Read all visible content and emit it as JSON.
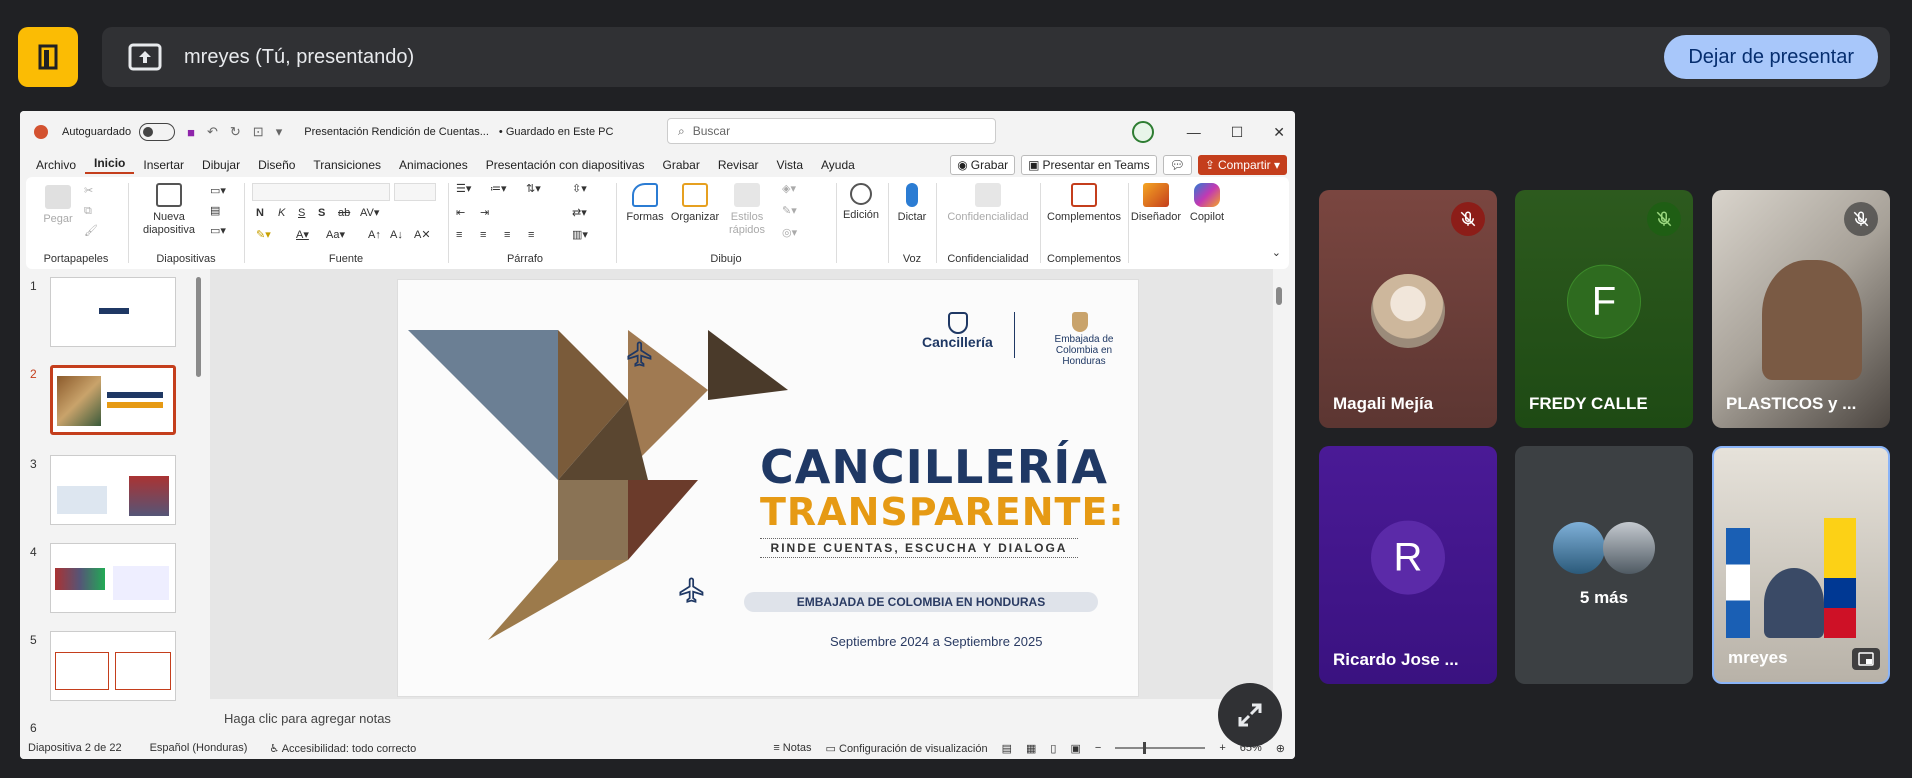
{
  "meet": {
    "presenter_label": "mreyes (Tú, presentando)",
    "stop_presenting_label": "Dejar de presentar"
  },
  "ppt": {
    "autosave_label": "Autoguardado",
    "file_name": "Presentación Rendición de Cuentas...",
    "save_status": "• Guardado en Este PC",
    "search_placeholder": "Buscar",
    "menu": [
      "Archivo",
      "Inicio",
      "Insertar",
      "Dibujar",
      "Diseño",
      "Transiciones",
      "Animaciones",
      "Presentación con diapositivas",
      "Grabar",
      "Revisar",
      "Vista",
      "Ayuda"
    ],
    "record_btn": "Grabar",
    "teams_btn": "Presentar en Teams",
    "share_btn": "Compartir",
    "ribbon": {
      "pegar": "Pegar",
      "portapapeles": "Portapapeles",
      "nueva_diapositiva": "Nueva diapositiva",
      "diapositivas": "Diapositivas",
      "fuente": "Fuente",
      "parrafo": "Párrafo",
      "formas": "Formas",
      "organizar": "Organizar",
      "estilos": "Estilos rápidos",
      "dibujo": "Dibujo",
      "edicion": "Edición",
      "dictar": "Dictar",
      "voz": "Voz",
      "confidencialidad_btn": "Confidencialidad",
      "confidencialidad": "Confidencialidad",
      "complementos_btn": "Complementos",
      "complementos": "Complementos",
      "disenador": "Diseñador",
      "copilot": "Copilot"
    },
    "thumb_numbers": [
      "1",
      "2",
      "3",
      "4",
      "5",
      "6"
    ],
    "notes_placeholder": "Haga clic para agregar notas",
    "status": {
      "slide_count": "Diapositiva 2 de 22",
      "language": "Español (Honduras)",
      "accessibility": "Accesibilidad: todo correcto",
      "notes": "Notas",
      "view_config": "Configuración de visualización",
      "zoom": "65%"
    }
  },
  "slide": {
    "org": "Cancillería",
    "embassy_logo_text": "Embajada de Colombia en Honduras",
    "title_line1": "CANCILLERÍA",
    "title_line2": "TRANSPARENTE:",
    "tagline": "RINDE CUENTAS, ESCUCHA Y DIALOGA",
    "embassy": "EMBAJADA DE COLOMBIA EN HONDURAS",
    "period": "Septiembre 2024 a  Septiembre 2025"
  },
  "participants": [
    {
      "name": "Magali Mejía",
      "muted": true
    },
    {
      "name": "FREDY CALLE",
      "muted": true,
      "initial": "F"
    },
    {
      "name": "PLASTICOS y ...",
      "muted": true
    },
    {
      "name": "Ricardo Jose ...",
      "initial": "R"
    },
    {
      "name": "5 más"
    },
    {
      "name": "mreyes"
    }
  ],
  "colors": {
    "accent_yellow": "#fbbc04",
    "stop_btn": "#a8c7fa",
    "ppt_orange": "#c43e1c",
    "slide_navy": "#1f3864",
    "slide_gold": "#e69a14"
  }
}
